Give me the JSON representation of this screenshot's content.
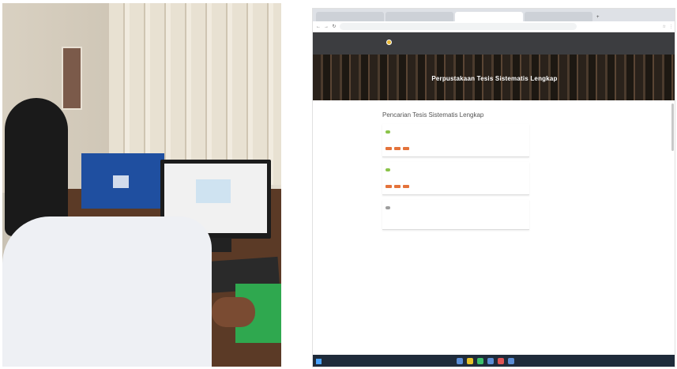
{
  "photo": {
    "icon": "photo-of-person-at-computer"
  },
  "browser": {
    "tabs": [
      {
        "label": "",
        "active": false
      },
      {
        "label": "",
        "active": false
      },
      {
        "label": "",
        "active": true
      },
      {
        "label": "",
        "active": false
      }
    ],
    "new_tab_label": "+",
    "url": "",
    "nav": {
      "back": "←",
      "forward": "→",
      "reload": "↻"
    },
    "toolbar_icons": [
      "☆",
      "⋮"
    ]
  },
  "site": {
    "logo_text": "",
    "menu": [
      "",
      "",
      "",
      "",
      ""
    ],
    "hero_title": "Perpustakaan Tesis Sistematis Lengkap",
    "page_title": "Pencarian Tesis Sistematis Lengkap"
  },
  "cards": [
    {
      "badge": "",
      "badge_color": "#8bc34a",
      "title": "",
      "desc": "",
      "date": "",
      "buttons": [
        "",
        "",
        ""
      ]
    },
    {
      "badge": "",
      "badge_color": "#8bc34a",
      "title": "",
      "desc": "",
      "date": "",
      "buttons": [
        "",
        "",
        ""
      ]
    },
    {
      "badge": "",
      "badge_color": "#9e9e9e",
      "title": "",
      "desc": "",
      "date": "",
      "buttons": []
    }
  ],
  "taskbar": {
    "clock": ""
  },
  "colors": {
    "site_nav": "#3c3d40",
    "button": "#e4733b",
    "badge_green": "#8bc34a",
    "badge_grey": "#9e9e9e",
    "taskbar": "#1f2b3a"
  }
}
